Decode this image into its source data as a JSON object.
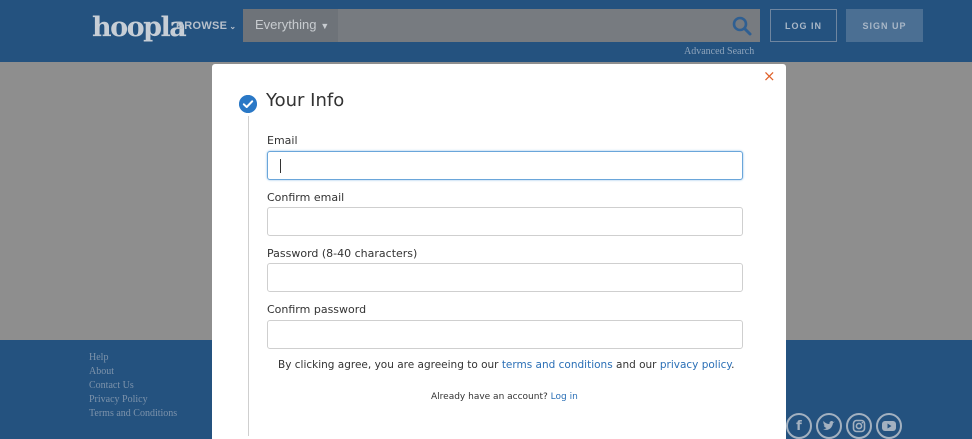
{
  "header": {
    "logo": "hoopla",
    "browse_label": "BROWSE",
    "search_category": "Everything",
    "advanced_search": "Advanced Search",
    "login_label": "LOG IN",
    "signup_label": "SIGN UP"
  },
  "footer": {
    "links": [
      "Help",
      "About",
      "Contact Us",
      "Privacy Policy",
      "Terms and Conditions"
    ]
  },
  "modal": {
    "close_symbol": "×",
    "title": "Your Info",
    "fields": [
      {
        "label": "Email",
        "value": ""
      },
      {
        "label": "Confirm email",
        "value": ""
      },
      {
        "label": "Password (8-40 characters)",
        "value": ""
      },
      {
        "label": "Confirm password",
        "value": ""
      }
    ],
    "agree_prefix": "By clicking agree, you are agreeing to our ",
    "terms_link": "terms and conditions",
    "agree_middle": " and our ",
    "privacy_link": "privacy policy",
    "agree_suffix": ".",
    "already_prefix": "Already have an account? ",
    "login_link": "Log in"
  },
  "colors": {
    "header_bg": "#24527f",
    "accent_blue": "#2a78c6",
    "close_orange": "#e0612a"
  },
  "icons": [
    "search-icon",
    "check-circle-icon",
    "close-icon",
    "facebook-icon",
    "twitter-icon",
    "instagram-icon",
    "youtube-icon"
  ]
}
